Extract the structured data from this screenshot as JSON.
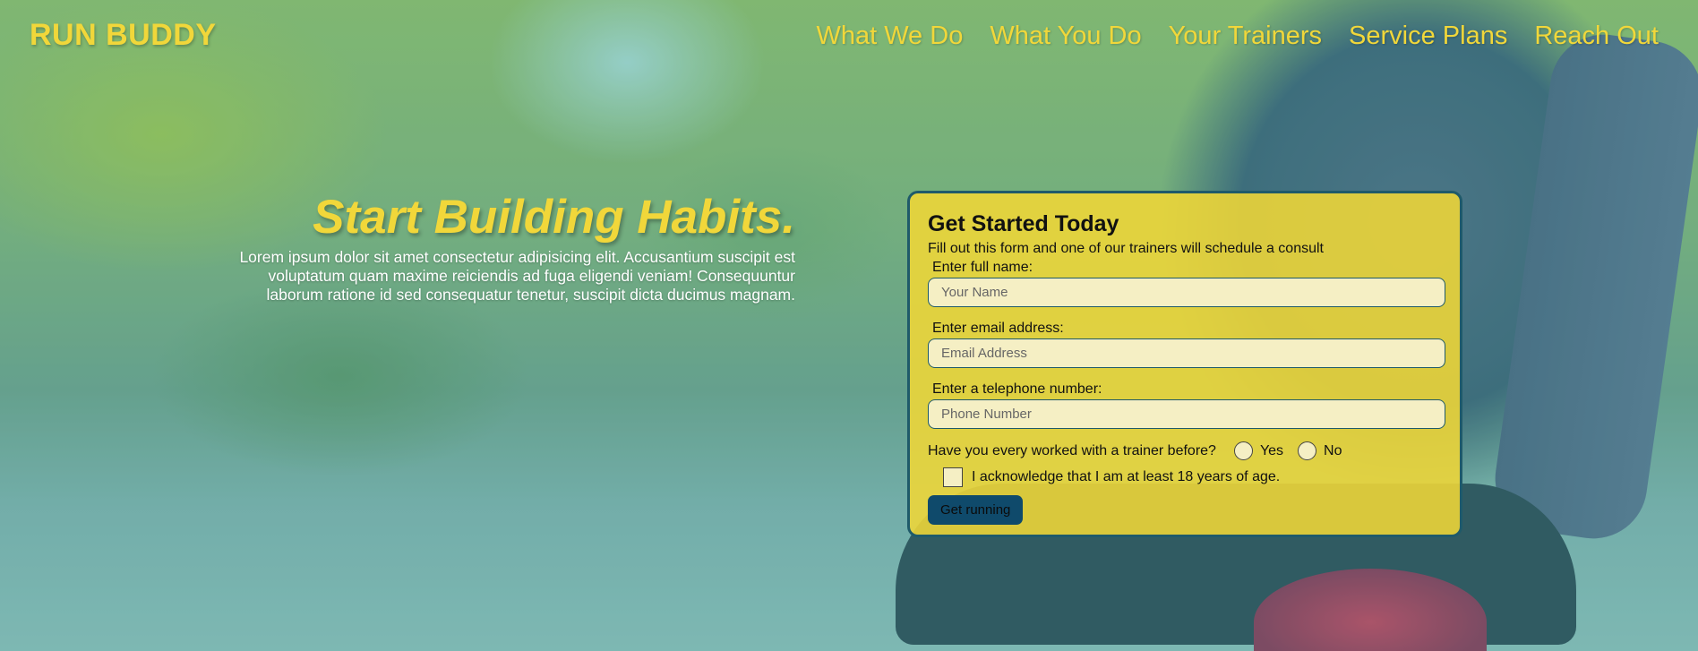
{
  "header": {
    "brand": "RUN BUDDY",
    "nav": [
      "What We Do",
      "What You Do",
      "Your Trainers",
      "Service Plans",
      "Reach Out"
    ]
  },
  "hero": {
    "headline": "Start Building Habits.",
    "intro": "Lorem ipsum dolor sit amet consectetur adipisicing elit. Accusantium suscipit est voluptatum quam maxime reiciendis ad fuga eligendi veniam! Consequuntur laborum ratione id sed consequatur tenetur, suscipit dicta ducimus magnam."
  },
  "form": {
    "title": "Get Started Today",
    "subtitle": "Fill out this form and one of our trainers will schedule a consult",
    "name_label": "Enter full name:",
    "name_placeholder": "Your Name",
    "email_label": "Enter email address:",
    "email_placeholder": "Email Address",
    "phone_label": "Enter a telephone number:",
    "phone_placeholder": "Phone Number",
    "trainer_question": "Have you every worked with a trainer before?",
    "yes_label": "Yes",
    "no_label": "No",
    "ack_label": "I acknowledge that I am at least 18 years of age.",
    "submit_label": "Get running"
  },
  "colors": {
    "accent": "#f1d73a",
    "card": "#f0d737",
    "button": "#0f4a6b",
    "border": "#1f5a6a"
  }
}
